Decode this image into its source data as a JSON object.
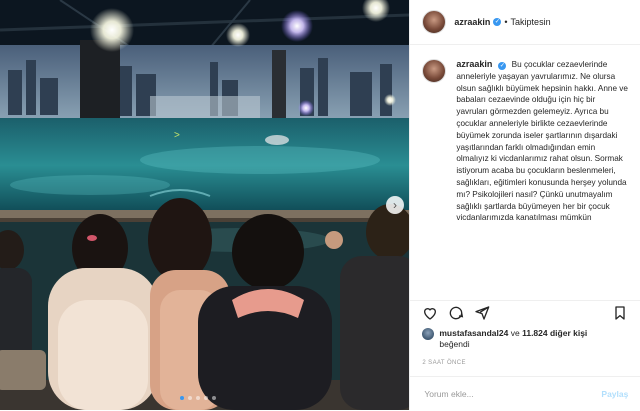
{
  "header": {
    "username": "azraakin",
    "separator": "•",
    "follow_label": "Takiptesin"
  },
  "caption": {
    "username": "azraakin",
    "text": "Bu çocuklar cezaevlerinde anneleriyle yaşayan yavrularımız. Ne olursa olsun sağlıklı büyümek hepsinin hakkı. Anne ve babaları cezaevinde olduğu için hiç bir yavruları görmezden gelemeyiz. Ayrıca bu çocuklar anneleriyle birlikte cezaevlerinde büyümek zorunda iseler şartlarının dışardaki yaşıtlarından farklı olmadığından emin olmalıyız ki vicdanlarımız rahat olsun. Sormak istiyorum acaba bu çocukların beslenmeleri, sağlıkları, eğitimleri konusunda herşey yolunda mı? Psikolojileri nasıl? Çünkü unutmayalım sağlıklı şartlarda büyümeyen her bir çocuk vicdanlarımızda kanatılması mümkün"
  },
  "likes": {
    "liker": "mustafasandal24",
    "connector": "ve",
    "others": "11.824 diğer kişi",
    "suffix": "beğendi"
  },
  "timestamp": "2 SAAT ÖNCE",
  "comment": {
    "placeholder": "Yorum ekle...",
    "post_label": "Paylaş"
  },
  "colors": {
    "verified": "#3897f0",
    "post_disabled": "#b2dffc",
    "carousel_active_dot": "#3897f0"
  },
  "carousel": {
    "count": 5,
    "active_index": 0
  },
  "icons": [
    "heart-icon",
    "comment-icon",
    "share-icon",
    "bookmark-icon",
    "verified-icon",
    "next-arrow-icon"
  ]
}
